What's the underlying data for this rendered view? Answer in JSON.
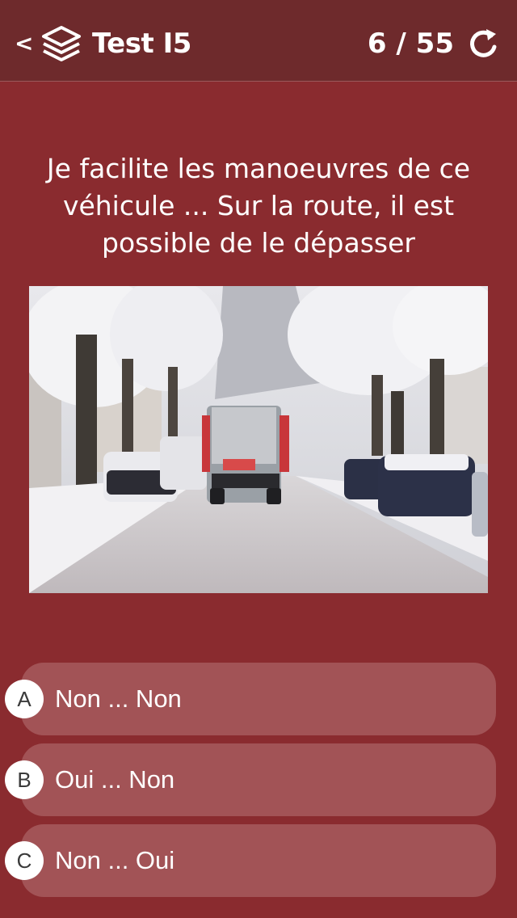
{
  "header": {
    "back_label": "<",
    "title": "Test I5",
    "counter": "6 / 55",
    "icons": {
      "left": "layers-stack-icon",
      "right": "refresh-icon"
    }
  },
  "question": {
    "text": "Je facilite les manoeuvres de ce véhicule ... Sur la route, il est possible de le dépasser"
  },
  "answers": [
    {
      "letter": "A",
      "text": "Non ... Non"
    },
    {
      "letter": "B",
      "text": "Oui ... Non"
    },
    {
      "letter": "C",
      "text": "Non ... Oui"
    }
  ],
  "colors": {
    "background": "#8a2b2f",
    "header": "#6e2a2c",
    "answer_bg": "#a25356",
    "text": "#ffffff"
  }
}
